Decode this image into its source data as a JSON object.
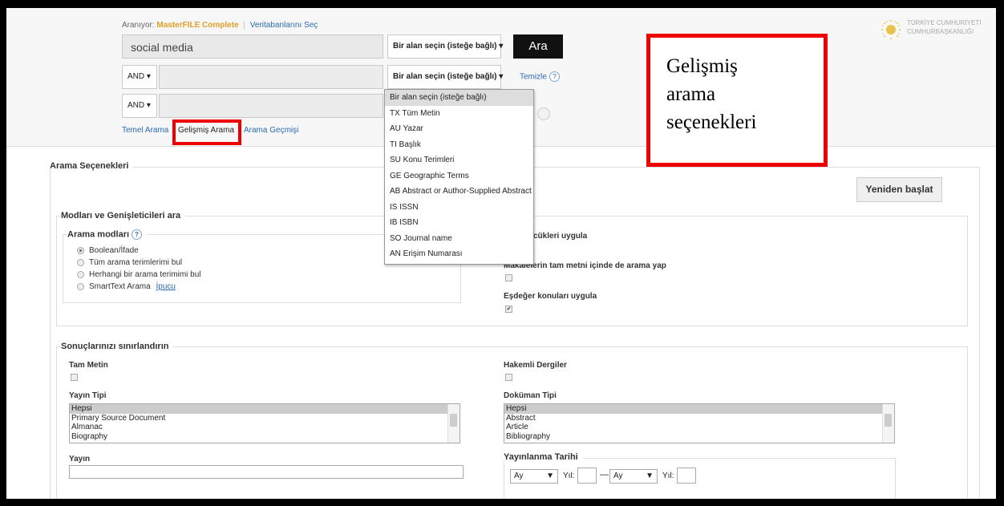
{
  "header": {
    "searching_label": "Aranıyor:",
    "database_name": "MasterFILE Complete",
    "choose_db_link": "Veritabanlarını Seç",
    "search_value": "social media",
    "field_select_label": "Bir alan seçin (isteğe bağlı)",
    "search_button": "Ara",
    "boolean_op": "AND",
    "clear_link": "Temizle",
    "help_symbol": "?",
    "nav": {
      "basic": "Temel Arama",
      "advanced": "Gelişmiş Arama",
      "history": "Arama Geçmişi"
    },
    "emblem_text_line1": "TÜRKİYE CUMHURİYETİ",
    "emblem_text_line2": "CUMHURBAŞKANLIĞI"
  },
  "callout": {
    "line1": "Gelişmiş",
    "line2": "arama",
    "line3": "seçenekleri"
  },
  "field_dropdown": {
    "options": [
      "Bir alan seçin (isteğe bağlı)",
      "TX Tüm Metin",
      "AU Yazar",
      "TI Başlık",
      "SU Konu Terimleri",
      "GE Geographic Terms",
      "AB Abstract or Author-Supplied Abstract",
      "IS ISSN",
      "IB ISBN",
      "SO Journal name",
      "AN Erişim Numarası"
    ]
  },
  "options": {
    "section_title": "Arama Seçenekleri",
    "reset_button": "Yeniden başlat",
    "modes_section": "Modları ve Genişleticileri ara",
    "modes_title": "Arama modları",
    "modes": [
      {
        "label": "Boolean/İfade",
        "checked": true
      },
      {
        "label": "Tüm arama terimlerimi bul",
        "checked": false
      },
      {
        "label": "Herhangi bir arama terimimi bul",
        "checked": false
      },
      {
        "label": "SmartText Arama",
        "checked": false
      }
    ],
    "tip_link": "İpucu",
    "expander_related": "zcükleri uygula",
    "expander_fulltext": "Makalelerin tam metni içinde de arama yap",
    "expander_fulltext_checked": false,
    "expander_equiv": "Eşdeğer konuları uygula",
    "expander_equiv_checked": true
  },
  "limits": {
    "section_title": "Sonuçlarınızı sınırlandırın",
    "full_text": "Tam Metin",
    "peer_reviewed": "Hakemli Dergiler",
    "pub_type_label": "Yayın Tipi",
    "pub_types": [
      "Hepsi",
      "Primary Source Document",
      "Almanac",
      "Biography"
    ],
    "doc_type_label": "Doküman Tipi",
    "doc_types": [
      "Hepsi",
      "Abstract",
      "Article",
      "Bibliography"
    ],
    "publication_label": "Yayın",
    "pub_date_label": "Yayınlanma Tarihi",
    "month_placeholder": "Ay",
    "year_label": "Yıl:",
    "dash": "—"
  }
}
